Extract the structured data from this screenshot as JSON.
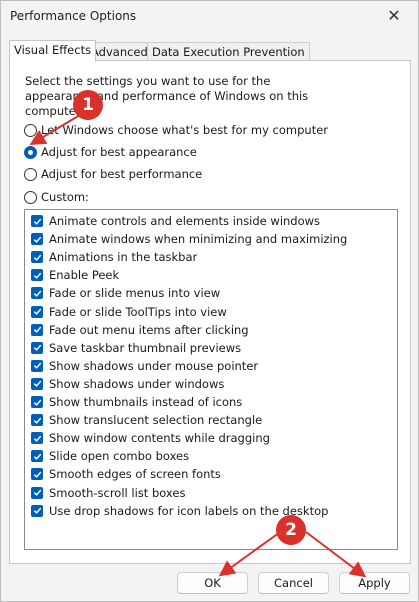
{
  "window": {
    "title": "Performance Options",
    "close_glyph": "✕"
  },
  "tabs": [
    {
      "label": "Visual Effects",
      "active": true
    },
    {
      "label": "Advanced",
      "active": false
    },
    {
      "label": "Data Execution Prevention",
      "active": false
    }
  ],
  "description": "Select the settings you want to use for the appearance and performance of Windows on this computer.",
  "radios": [
    {
      "label": "Let Windows choose what's best for my computer",
      "selected": false
    },
    {
      "label": "Adjust for best appearance",
      "selected": true
    },
    {
      "label": "Adjust for best performance",
      "selected": false
    },
    {
      "label": "Custom:",
      "selected": false
    }
  ],
  "effects": [
    {
      "label": "Animate controls and elements inside windows",
      "checked": true
    },
    {
      "label": "Animate windows when minimizing and maximizing",
      "checked": true
    },
    {
      "label": "Animations in the taskbar",
      "checked": true
    },
    {
      "label": "Enable Peek",
      "checked": true
    },
    {
      "label": "Fade or slide menus into view",
      "checked": true
    },
    {
      "label": "Fade or slide ToolTips into view",
      "checked": true
    },
    {
      "label": "Fade out menu items after clicking",
      "checked": true
    },
    {
      "label": "Save taskbar thumbnail previews",
      "checked": true
    },
    {
      "label": "Show shadows under mouse pointer",
      "checked": true
    },
    {
      "label": "Show shadows under windows",
      "checked": true
    },
    {
      "label": "Show thumbnails instead of icons",
      "checked": true
    },
    {
      "label": "Show translucent selection rectangle",
      "checked": true
    },
    {
      "label": "Show window contents while dragging",
      "checked": true
    },
    {
      "label": "Slide open combo boxes",
      "checked": true
    },
    {
      "label": "Smooth edges of screen fonts",
      "checked": true
    },
    {
      "label": "Smooth-scroll list boxes",
      "checked": true
    },
    {
      "label": "Use drop shadows for icon labels on the desktop",
      "checked": true
    }
  ],
  "buttons": {
    "ok": "OK",
    "cancel": "Cancel",
    "apply": "Apply"
  },
  "annotations": {
    "badge1": "1",
    "badge2": "2"
  },
  "colors": {
    "accent": "#005fb8",
    "annotation": "#d9312b"
  }
}
